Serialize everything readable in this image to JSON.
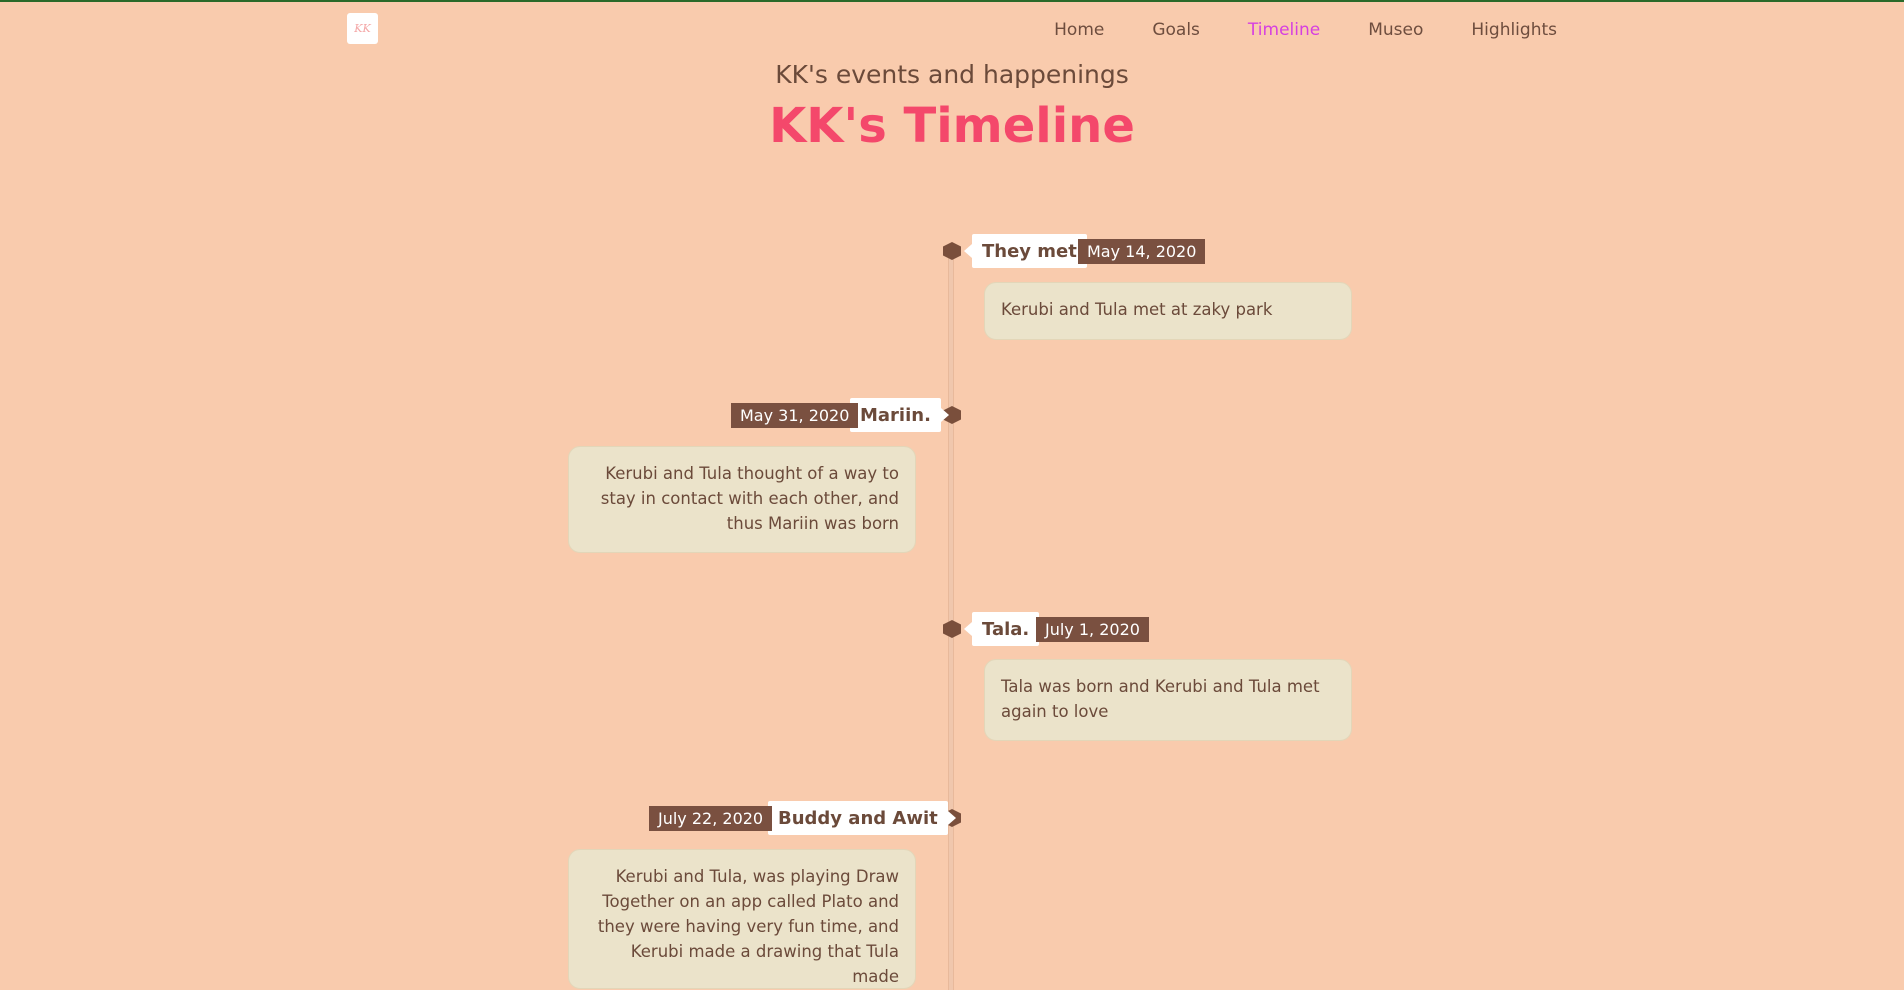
{
  "header": {
    "logo_text": "KK",
    "nav": [
      {
        "label": "Home"
      },
      {
        "label": "Goals"
      },
      {
        "label": "Timeline",
        "active": true
      },
      {
        "label": "Museo"
      },
      {
        "label": "Highlights"
      }
    ]
  },
  "page": {
    "subtitle": "KK's events and happenings",
    "title": "KK's Timeline"
  },
  "timeline": [
    {
      "title": "They met",
      "date": "May 14, 2020",
      "text": "Kerubi and Tula met at zaky park",
      "side": "right"
    },
    {
      "title": "Mariin.",
      "date": "May 31, 2020",
      "text": "Kerubi and Tula thought of a way to stay in contact with each other, and thus Mariin was born",
      "side": "left"
    },
    {
      "title": "Tala.",
      "date": "July 1, 2020",
      "text": "Tala was born and Kerubi and Tula met again to love",
      "side": "right"
    },
    {
      "title": "Buddy and Awit",
      "date": "July 22, 2020",
      "text": "Kerubi and Tula, was playing Draw Together on an app called Plato and they were having very fun time, and Kerubi made a drawing that Tula made",
      "side": "left"
    }
  ],
  "colors": {
    "background": "#f9cbad",
    "title": "#f4486b",
    "nav_active": "#d63fe0",
    "accent_brown": "#7a5040",
    "card": "#ebe3ca"
  }
}
